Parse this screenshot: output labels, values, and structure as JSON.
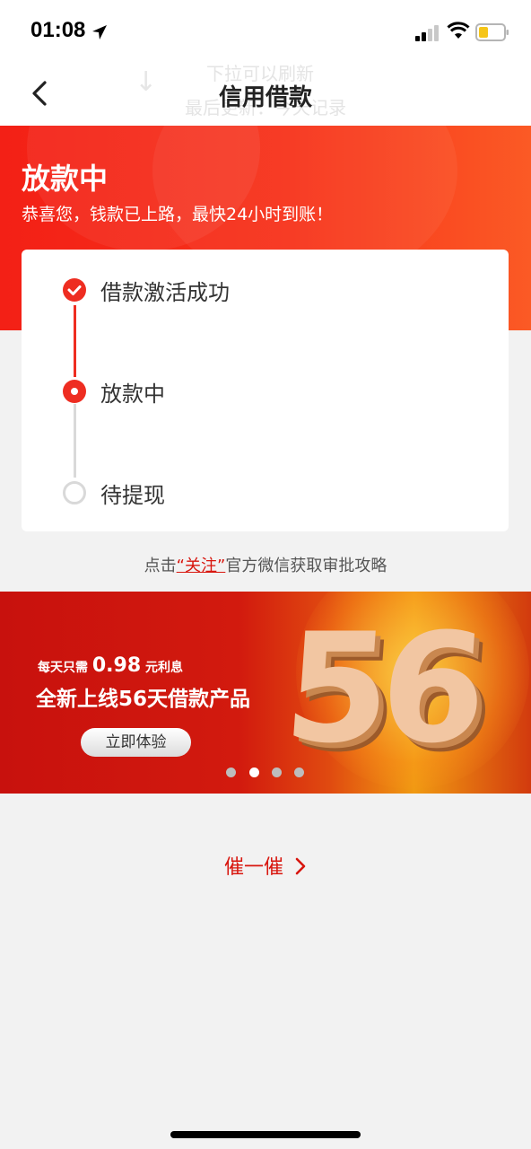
{
  "status": {
    "time": "01:08"
  },
  "nav": {
    "title": "信用借款",
    "pull_line1": "下拉可以刷新",
    "pull_line2": "最后更新：今天记录"
  },
  "hero": {
    "title": "放款中",
    "subtitle": "恭喜您，钱款已上路，最快24小时到账！"
  },
  "steps": [
    {
      "label": "借款激活成功",
      "state": "done"
    },
    {
      "label": "放款中",
      "state": "current"
    },
    {
      "label": "待提现",
      "state": "pending"
    }
  ],
  "follow_tip": {
    "prefix": "点击",
    "link": "“关注”",
    "suffix": "官方微信获取审批攻略"
  },
  "banner": {
    "line1_prefix": "每天只需",
    "line1_value": "0.98",
    "line1_suffix": "元利息",
    "line2": "全新上线56天借款产品",
    "button": "立即体验",
    "big_number": "56",
    "page_count": 4,
    "active_page": 2
  },
  "urge": {
    "label": "催一催"
  },
  "colors": {
    "brand_red": "#ee2d21",
    "link_red": "#d8160e"
  }
}
